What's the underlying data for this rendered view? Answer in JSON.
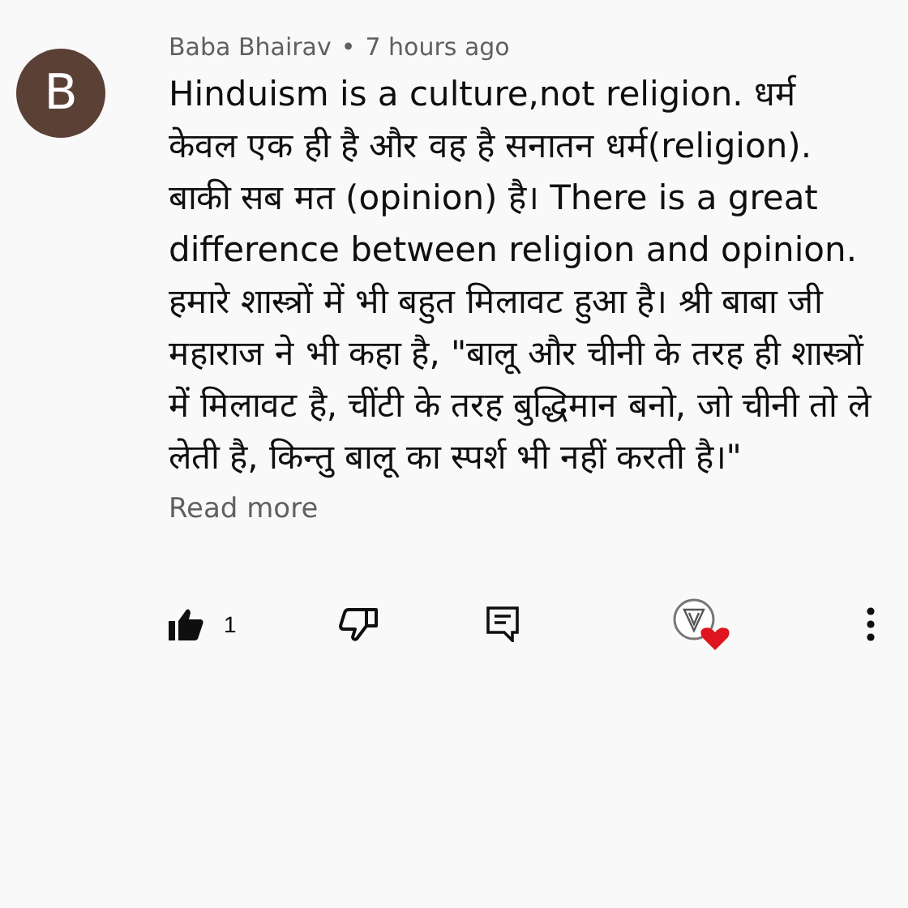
{
  "comment": {
    "avatar_letter": "B",
    "author": "Baba Bhairav",
    "separator": "•",
    "time": "7 hours ago",
    "text": "Hinduism is a culture,not religion. धर्म केवल एक ही है और वह है सनातन धर्म(religion). बाकी सब मत (opinion) है। There is a great difference between religion and opinion. हमारे शास्त्रों में भी बहुत मिलावट हुआ है। श्री बाबा जी महाराज ने भी कहा है, \"बालू और चीनी के तरह ही शास्त्रों में मिलावट है, चींटी के तरह बुद्धिमान बनो, जो चीनी तो ले लेती है, किन्तु बालू का स्पर्श भी नहीं करती है।\"",
    "read_more": "Read more",
    "like_count": "1",
    "creator_hearted": true
  }
}
